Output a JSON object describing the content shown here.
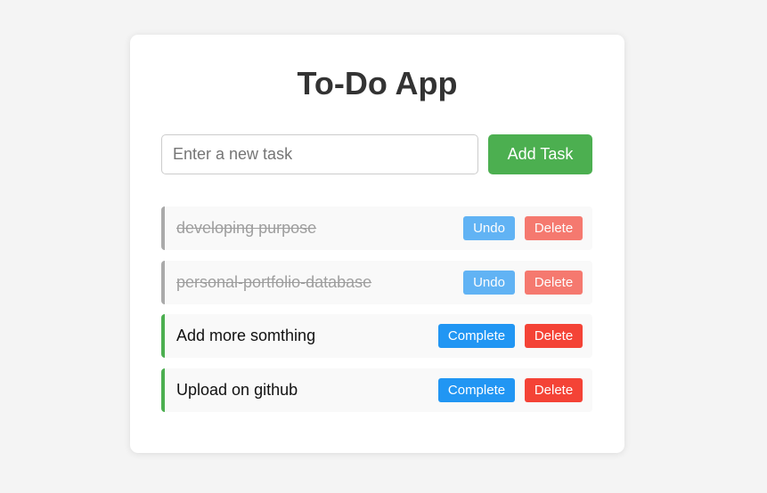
{
  "app": {
    "title": "To-Do App"
  },
  "new_task": {
    "placeholder": "Enter a new task",
    "value": "",
    "add_label": "Add Task"
  },
  "tasks": [
    {
      "text": "developing purpose",
      "completed": true,
      "toggle_label": "Undo",
      "delete_label": "Delete"
    },
    {
      "text": "personal-portfolio-database",
      "completed": true,
      "toggle_label": "Undo",
      "delete_label": "Delete"
    },
    {
      "text": "Add more somthing",
      "completed": false,
      "toggle_label": "Complete",
      "delete_label": "Delete"
    },
    {
      "text": "Upload on github",
      "completed": false,
      "toggle_label": "Complete",
      "delete_label": "Delete"
    }
  ],
  "colors": {
    "background": "#f4f4f4",
    "card": "#ffffff",
    "add_button": "#4caf50",
    "complete_button": "#2196f3",
    "delete_button": "#f44336",
    "active_border": "#4caf50",
    "done_border": "#aaaaaa"
  }
}
